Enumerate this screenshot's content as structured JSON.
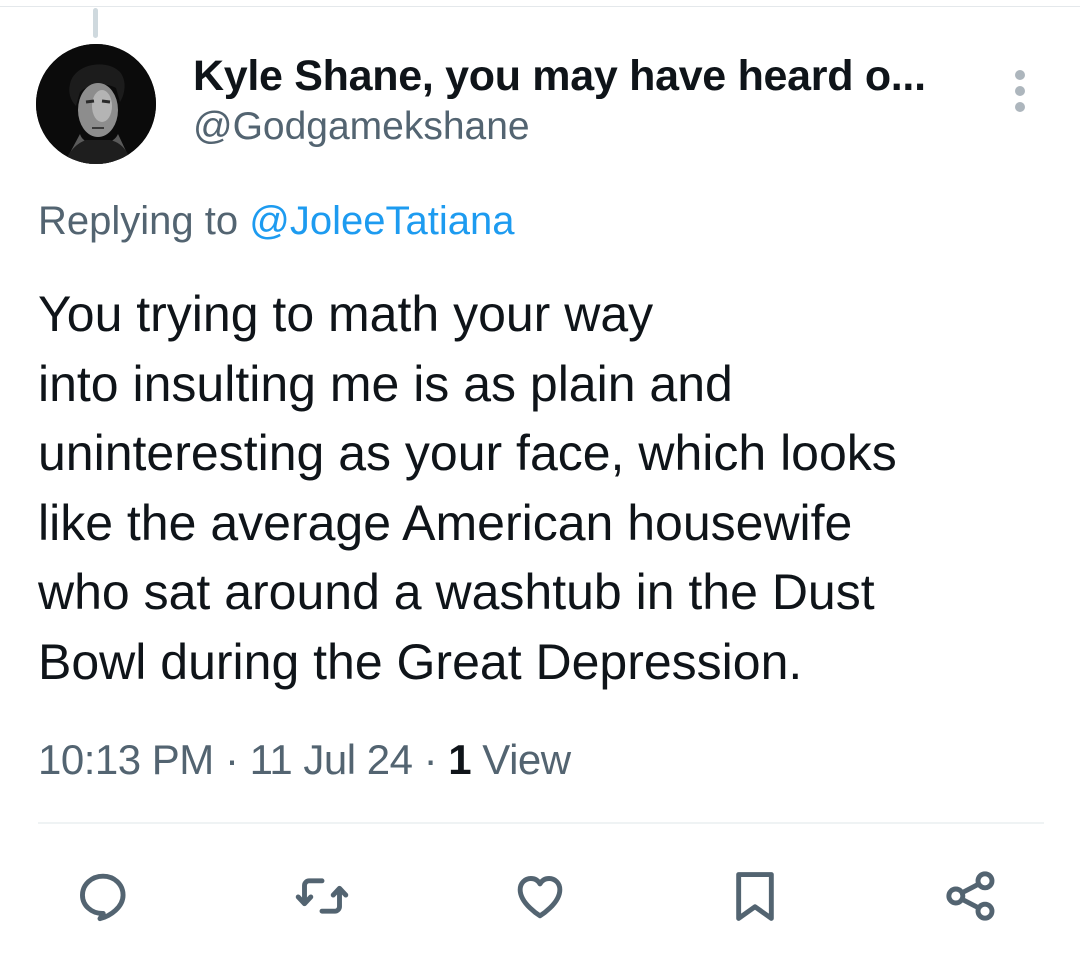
{
  "tweet": {
    "display_name": "Kyle Shane, you may have heard o...",
    "handle": "@Godgamekshane",
    "replying_prefix": "Replying to ",
    "replying_to": "@JoleeTatiana",
    "text_lines": [
      "You trying to math your way",
      "into insulting me is as plain and",
      "uninteresting as your face, which looks",
      "like the average American housewife",
      "who sat around a washtub in the Dust",
      "Bowl during the Great Depression."
    ],
    "time": "10:13 PM",
    "separator": " · ",
    "date": "11 Jul 24",
    "views_count": "1",
    "views_label": " View"
  },
  "icons": {
    "more": "more-vertical-icon",
    "reply": "reply-icon",
    "retweet": "retweet-icon",
    "like": "heart-icon",
    "bookmark": "bookmark-icon",
    "share": "share-icon"
  },
  "colors": {
    "text": "#0f1419",
    "secondary": "#536471",
    "link": "#1d9bf0",
    "divider": "#eff3f4"
  }
}
